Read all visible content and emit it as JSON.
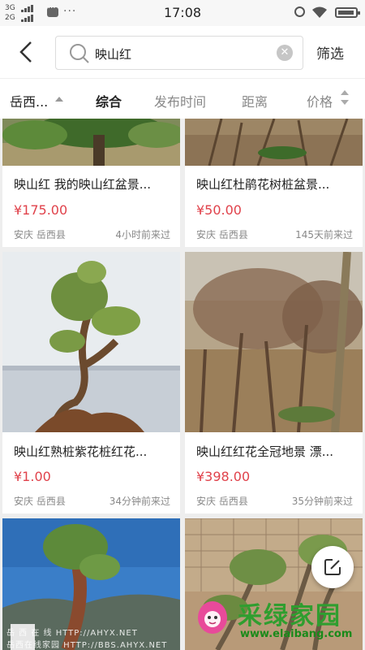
{
  "status_bar": {
    "signal_1": "3G",
    "signal_2": "2G",
    "time": "17:08"
  },
  "search": {
    "query": "映山红",
    "filter_label": "筛选"
  },
  "sort_bar": {
    "location": "岳西...",
    "options": [
      "综合",
      "发布时间",
      "距离",
      "价格"
    ],
    "active": "综合"
  },
  "listings": [
    {
      "title": "映山红 我的映山红盆景...",
      "price": "¥175.00",
      "location": "安庆 岳西县",
      "posted": "4小时前来过"
    },
    {
      "title": "映山红杜鹃花树桩盆景...",
      "price": "¥50.00",
      "location": "安庆 岳西县",
      "posted": "145天前来过"
    },
    {
      "title": "映山红熟桩紫花桩红花...",
      "price": "¥1.00",
      "location": "安庆 岳西县",
      "posted": "34分钟前来过"
    },
    {
      "title": "映山红红花全冠地景 漂...",
      "price": "¥398.00",
      "location": "安庆 岳西县",
      "posted": "35分钟前来过"
    },
    {
      "title": "",
      "price": "",
      "location": "",
      "posted": ""
    },
    {
      "title": "",
      "price": "",
      "location": "",
      "posted": ""
    }
  ],
  "watermark": {
    "brand": "采绿家园",
    "url": "www.elaibang.com",
    "left_line_1": "岳 西 在 线   HTTP://AHYX.NET",
    "left_line_2": "岳西在线家园   HTTP://BBS.AHYX.NET"
  },
  "colors": {
    "price": "#e0424b",
    "brand_green": "#2f9e2f"
  },
  "icons": [
    "back-arrow-icon",
    "search-icon",
    "clear-icon",
    "caret-up-icon",
    "sort-caret-icon",
    "edit-icon",
    "alarm-icon",
    "wifi-icon",
    "battery-icon"
  ]
}
